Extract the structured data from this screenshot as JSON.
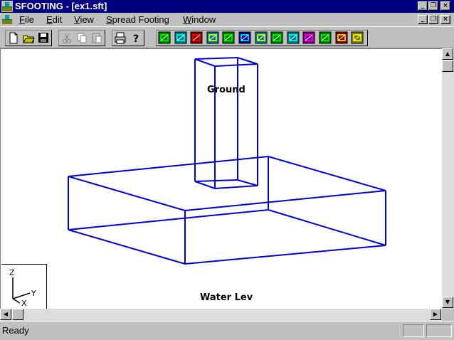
{
  "window": {
    "title": "SFOOTING - [ex1.sft]",
    "controls": {
      "minimize": "_",
      "restore": "❒",
      "close": "×"
    }
  },
  "menu": {
    "items": [
      {
        "label": "File",
        "icon": ""
      },
      {
        "label": "Edit"
      },
      {
        "label": "View"
      },
      {
        "label": "Spread Footing"
      },
      {
        "label": "Window"
      }
    ]
  },
  "toolbar": {
    "group1": [
      "new-document-icon",
      "open-folder-icon",
      "save-disk-icon"
    ],
    "group2": [
      "cut-icon",
      "copy-icon",
      "paste-icon"
    ],
    "group3": [
      "print-icon",
      "help-icon"
    ],
    "group4": [
      "footing-view-icon",
      "section-icon",
      "load-icon",
      "soil-icon",
      "elevation-icon",
      "bar-chart-icon",
      "layers-icon",
      "grid-icon",
      "graph-icon",
      "curve-icon",
      "check-icon",
      "results-icon",
      "report-icon"
    ]
  },
  "drawing": {
    "labels": {
      "ground": "Ground",
      "water": "Water Lev"
    },
    "axes": {
      "z": "Z",
      "y": "Y",
      "x": "X"
    },
    "line_color": "#0000cc"
  },
  "status": {
    "text": "Ready"
  },
  "colors": {
    "title_bg": "#000080",
    "face": "#c0c0c0"
  }
}
